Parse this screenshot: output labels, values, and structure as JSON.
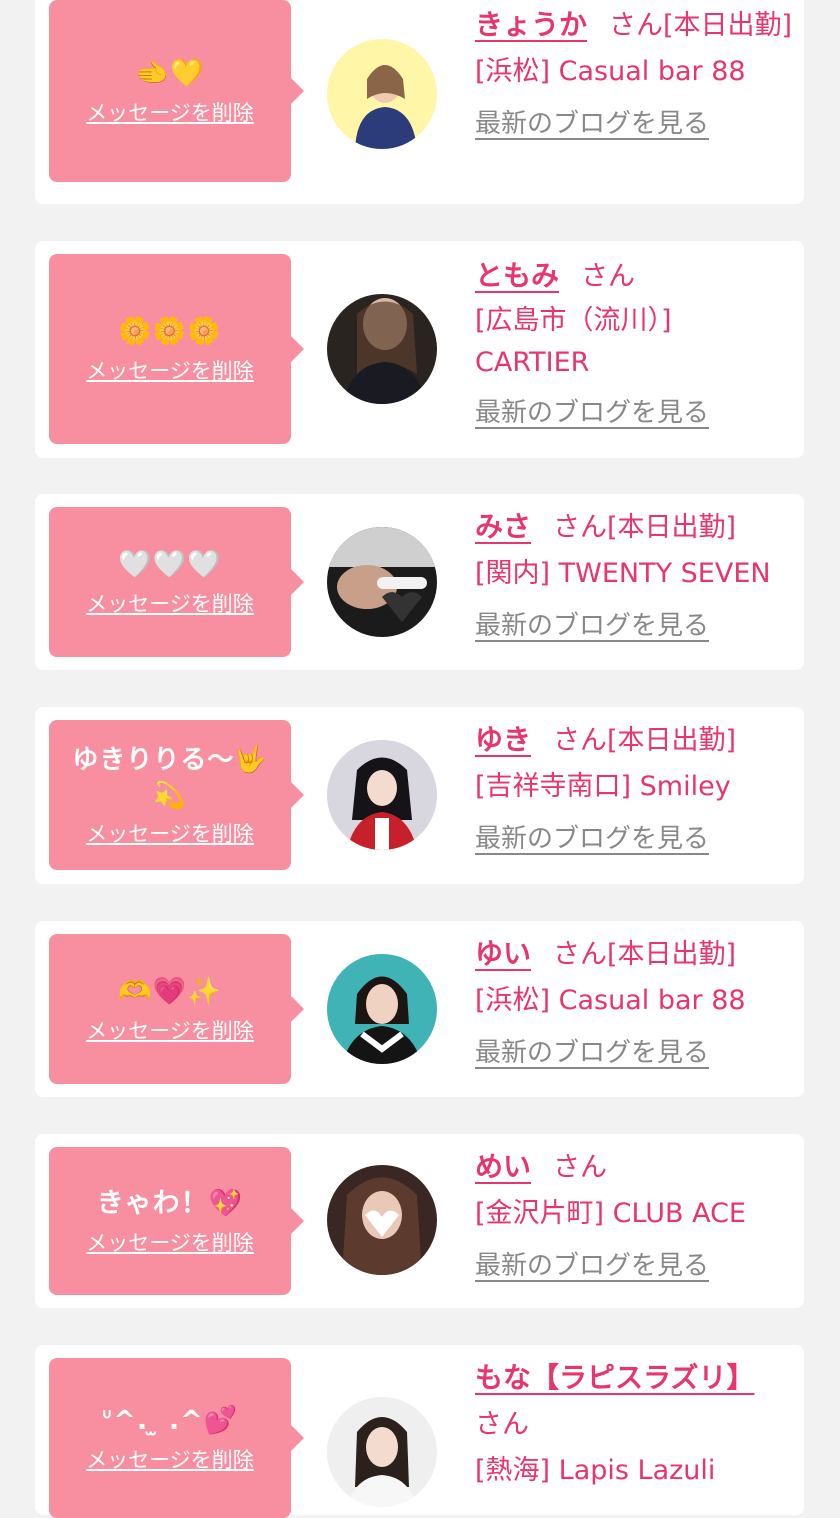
{
  "colors": {
    "accent": "#e8356c",
    "bubble": "#f78fa0",
    "background": "#f2f2f2",
    "link_gray": "#888888"
  },
  "delete_label": "メッセージを削除",
  "blog_label": "最新のブログを見る",
  "cards": [
    {
      "message": "🫲💛",
      "name": "きょうか",
      "san": "さん",
      "status": "[本日出勤]",
      "shop": "[浜松] Casual bar 88"
    },
    {
      "message": "🌼🌼🌼",
      "name": "ともみ",
      "san": "さん",
      "status": "",
      "shop": "[広島市（流川）] CARTIER"
    },
    {
      "message": "🤍🤍🤍",
      "name": "みさ",
      "san": "さん",
      "status": "[本日出勤]",
      "shop": "[関内] TWENTY SEVEN"
    },
    {
      "message": "ゆきりりる〜🤟💫",
      "name": "ゆき",
      "san": "さん",
      "status": "[本日出勤]",
      "shop": "[吉祥寺南口] Smiley"
    },
    {
      "message": "🫶💗✨",
      "name": "ゆい",
      "san": "さん",
      "status": "[本日出勤]",
      "shop": "[浜松] Casual bar 88"
    },
    {
      "message": "きゃわ！💖",
      "name": "めい",
      "san": "さん",
      "status": "",
      "shop": "[金沢片町] CLUB ACE"
    },
    {
      "message": "ᐡ^. ̫ .^💕",
      "name": "もな【ラピスラズリ】",
      "san": "さん",
      "status": "",
      "shop": "[熱海] Lapis Lazuli"
    }
  ]
}
